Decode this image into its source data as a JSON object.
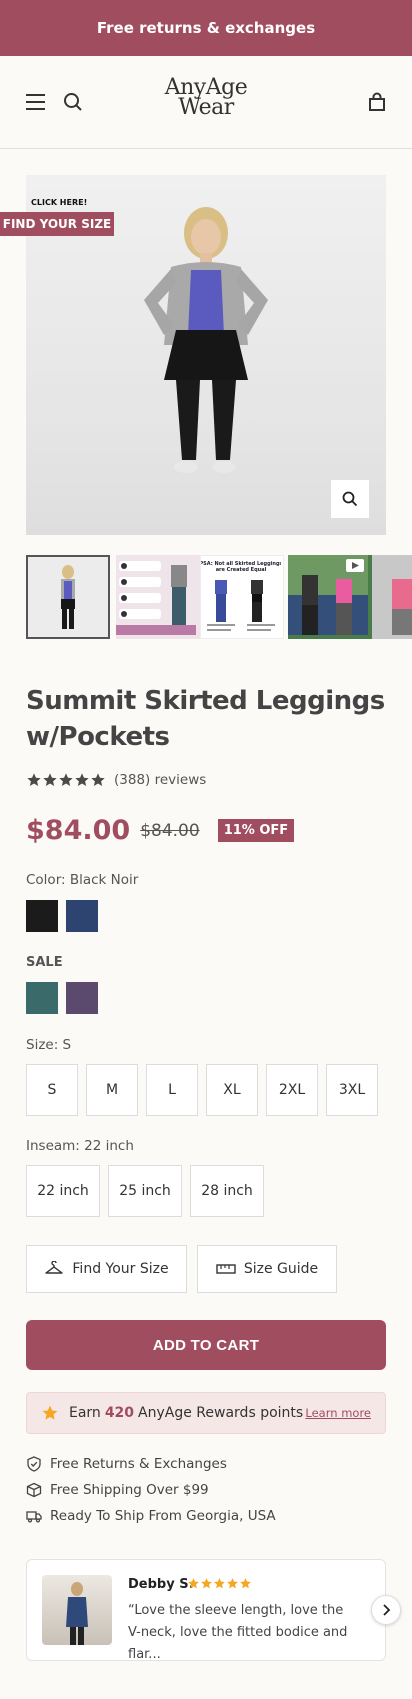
{
  "announcement": "Free returns & exchanges",
  "header": {
    "logo_line1": "AnyAge",
    "logo_line2": "Wear"
  },
  "gallery": {
    "find_size_hint": "CLICK HERE!",
    "find_size_badge": "FIND YOUR SIZE",
    "thumb3_caption": "PSA: Not all Skirted Leggings are Created Equal"
  },
  "product": {
    "title": "Summit Skirted Leggings w/Pockets",
    "rating_stars": 5,
    "reviews": "(388) reviews",
    "price": "$84.00",
    "compare_price": "$84.00",
    "discount": "11% OFF"
  },
  "colors": {
    "label": "Color: Black Noir",
    "swatches": [
      "#1b1b1b",
      "#2d4470"
    ],
    "sale_label": "SALE",
    "sale_swatches": [
      "#3b6a6a",
      "#5b4a6e"
    ]
  },
  "sizes": {
    "label": "Size: S",
    "options": [
      "S",
      "M",
      "L",
      "XL",
      "2XL",
      "3XL"
    ]
  },
  "inseam": {
    "label": "Inseam: 22 inch",
    "options": [
      "22 inch",
      "25 inch",
      "28 inch"
    ]
  },
  "buttons": {
    "find_size": "Find Your Size",
    "size_guide": "Size Guide",
    "add_to_cart": "ADD TO CART"
  },
  "rewards": {
    "prefix": "Earn",
    "points": "420",
    "suffix": "AnyAge Rewards points",
    "link": "Learn more"
  },
  "features": [
    "Free Returns & Exchanges",
    "Free Shipping Over $99",
    "Ready To Ship From Georgia, USA"
  ],
  "review": {
    "name": "Debby S.",
    "stars": 5,
    "text": "“Love the sleeve length, love the V-neck, love the fitted bodice and flar..."
  },
  "colors_theme": {
    "brand": "#a04d5f",
    "star": "#f5a623"
  }
}
